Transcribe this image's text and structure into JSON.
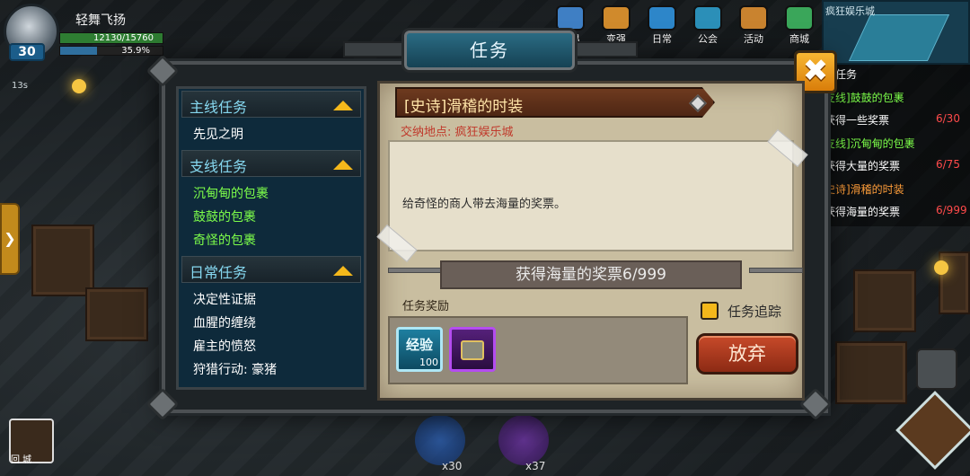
{
  "player": {
    "name": "轻舞飞扬",
    "level": "30",
    "hp_text": "12130/15760",
    "xp_text": "35.9%",
    "xp_fraction": 0.359,
    "timer": "13s"
  },
  "top_nav": [
    {
      "label": "交易",
      "icon": "exchange-icon",
      "color": "#3f7fc4"
    },
    {
      "label": "变强",
      "icon": "power-up-icon",
      "color": "#d08a2c"
    },
    {
      "label": "日常",
      "icon": "daily-icon",
      "color": "#2d86c9"
    },
    {
      "label": "公会",
      "icon": "guild-icon",
      "color": "#2b8fb8"
    },
    {
      "label": "活动",
      "icon": "event-icon",
      "color": "#c9832f"
    },
    {
      "label": "商城",
      "icon": "shop-cart-icon",
      "color": "#3aa65a"
    }
  ],
  "minimap": {
    "title": "疯狂娱乐城"
  },
  "tracker": [
    {
      "text": "线任务",
      "color": "#ffffff"
    },
    {
      "text": "支线]鼓鼓的包裹",
      "color": "#7dff4a"
    },
    {
      "text": "获得一些奖票",
      "color": "#ffffff",
      "count": "6/30"
    },
    {
      "text": "支线]沉甸甸的包裹",
      "color": "#7dff4a"
    },
    {
      "text": "获得大量的奖票",
      "color": "#ffffff",
      "count": "6/75"
    },
    {
      "text": "史诗]滑稽的时装",
      "color": "#ff9e3a"
    },
    {
      "text": "获得海量的奖票",
      "color": "#ffffff",
      "count": "6/999"
    }
  ],
  "modal": {
    "title": "任务",
    "close_label": "✖"
  },
  "quest_list": {
    "main": {
      "label": "主线任务",
      "items": [
        "先见之明"
      ]
    },
    "side": {
      "label": "支线任务",
      "items": [
        "沉甸甸的包裹",
        "鼓鼓的包裹",
        "奇怪的包裹"
      ]
    },
    "daily": {
      "label": "日常任务",
      "items": [
        "决定性证据",
        "血腥的缠绕",
        "雇主的愤怒",
        "狩猎行动:  豪猪"
      ]
    }
  },
  "quest_detail": {
    "title": "[史诗]滑稽的时装",
    "location": "交纳地点:  疯狂娱乐城",
    "description": "给奇怪的商人带去海量的奖票。",
    "progress": "获得海量的奖票6/999",
    "reward_title": "任务奖励",
    "reward_exp_label": "经验",
    "reward_exp_count": "100",
    "track_label": "任务追踪",
    "abandon_label": "放弃"
  },
  "bottom": {
    "home_label": "回  城",
    "count_left": "x30",
    "count_right": "x37"
  }
}
